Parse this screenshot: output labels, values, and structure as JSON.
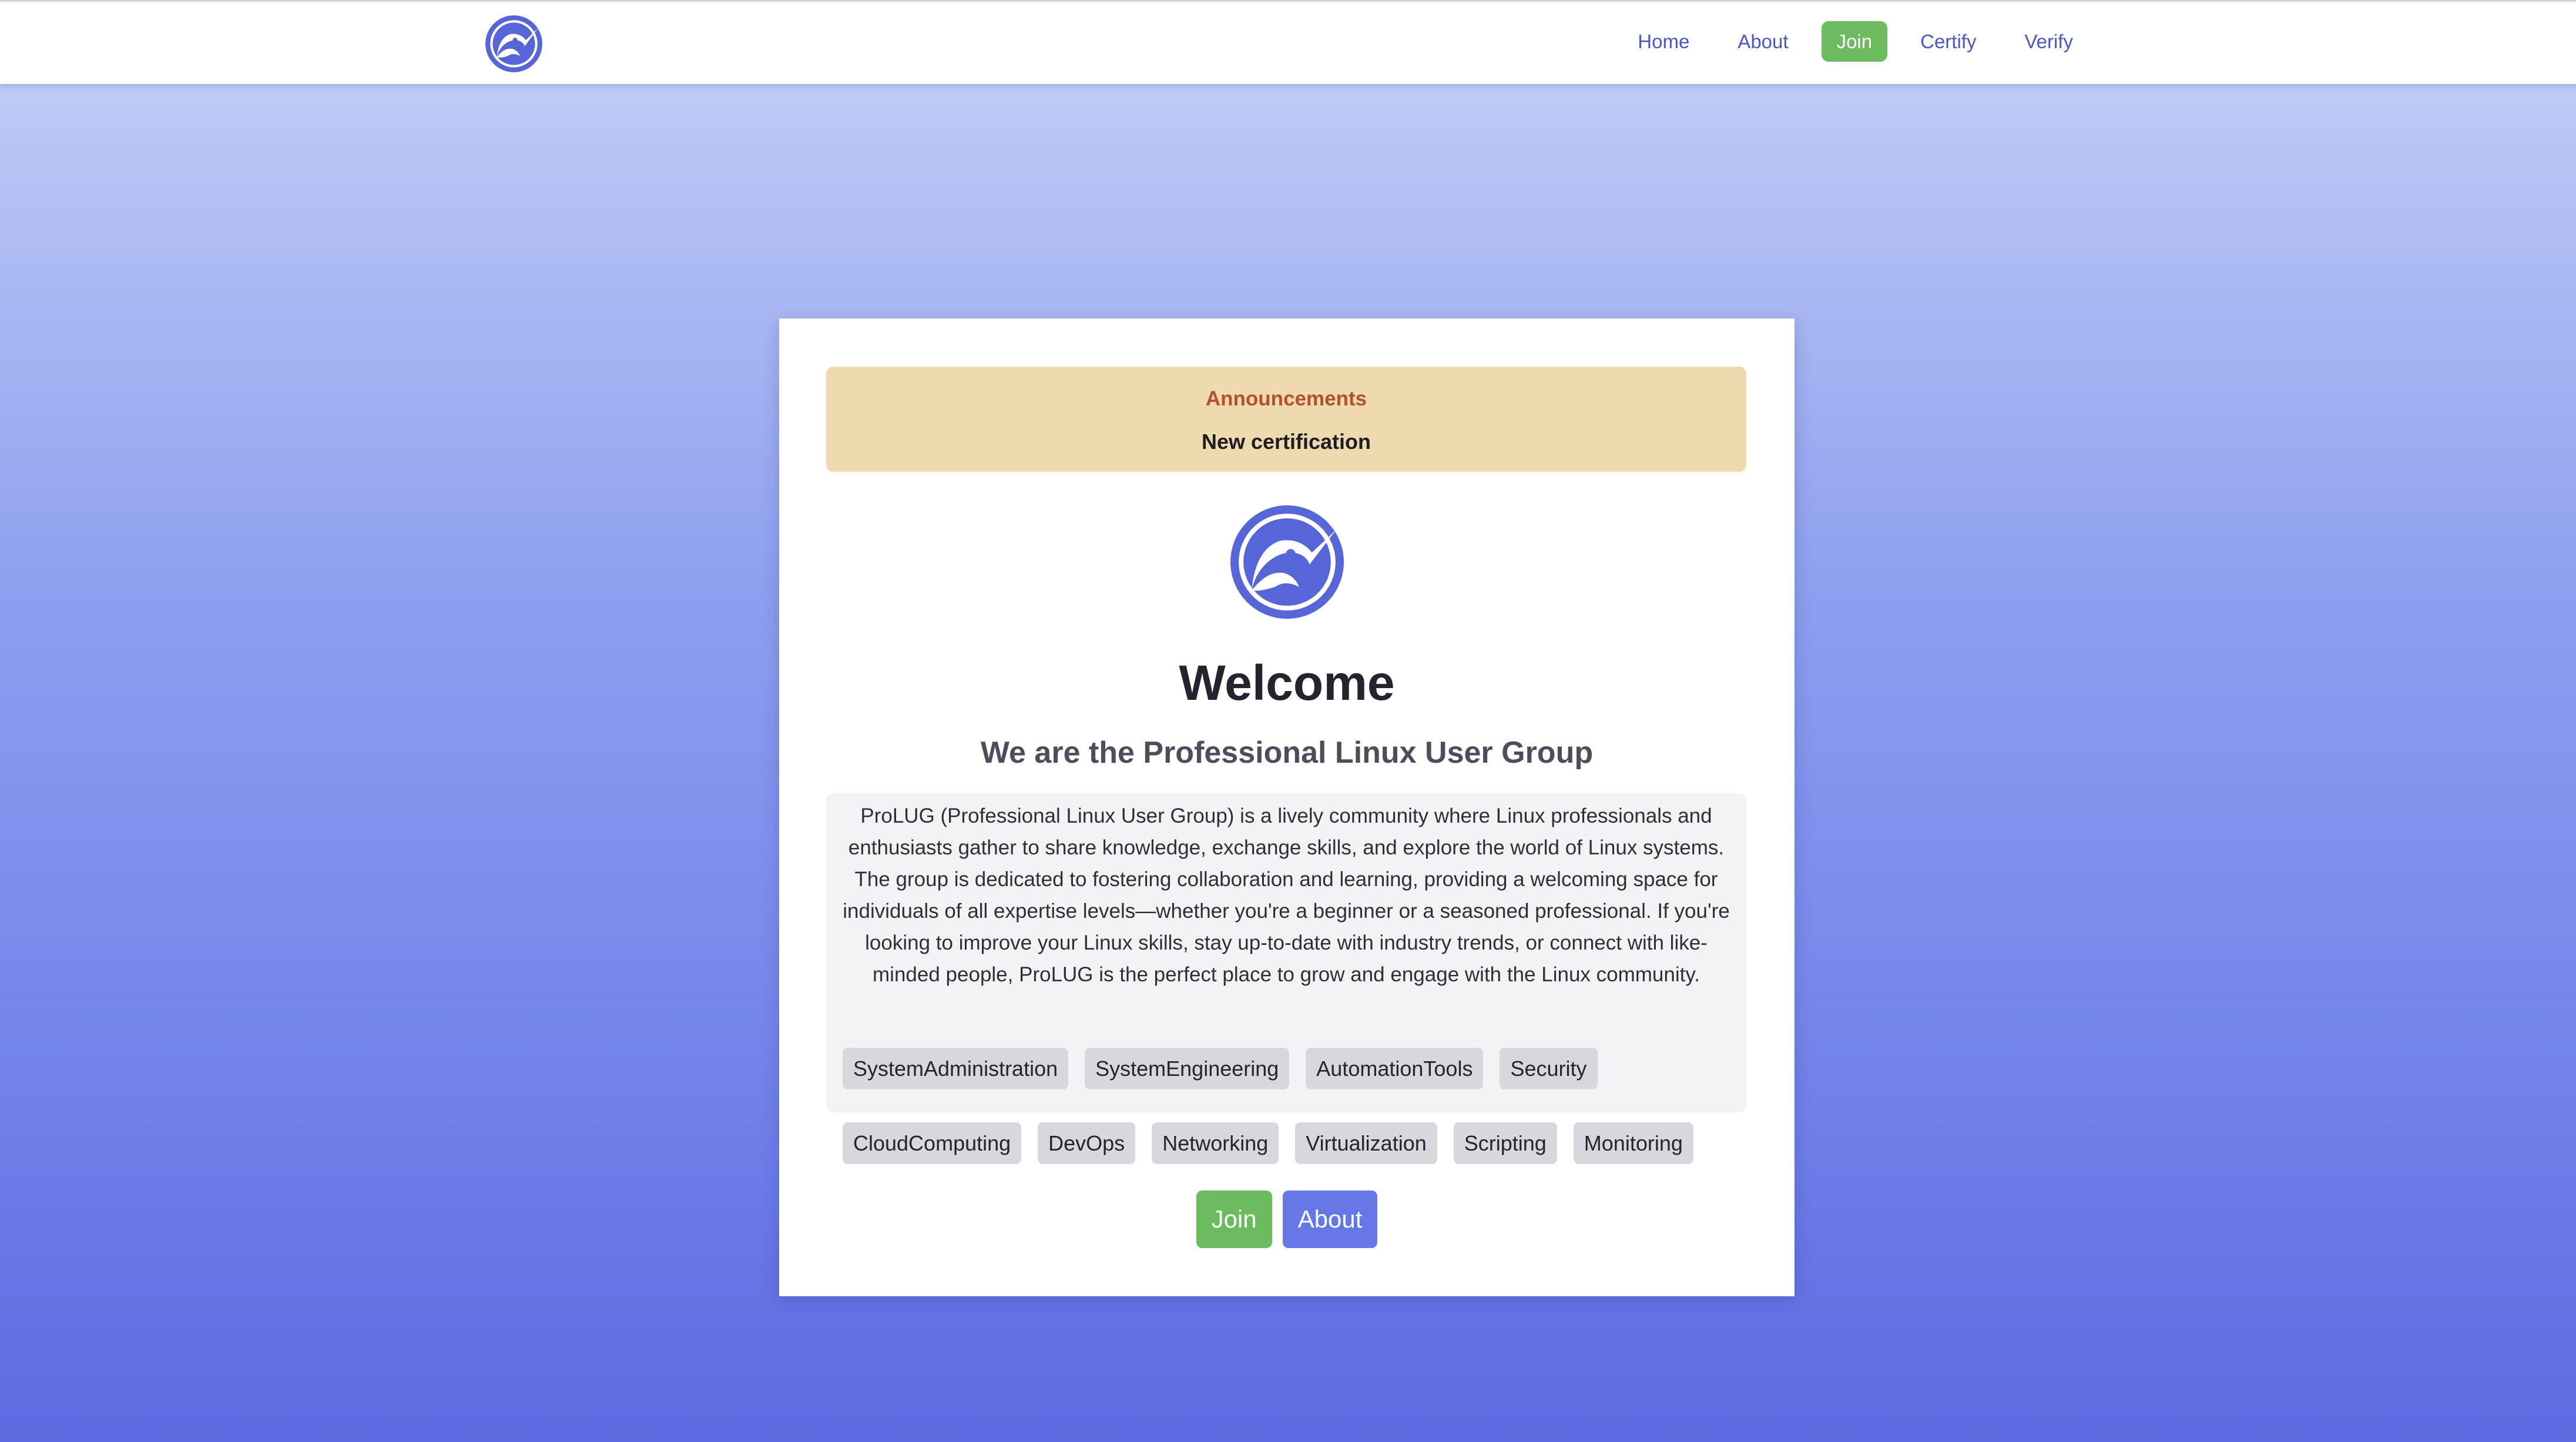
{
  "nav": {
    "links": [
      {
        "label": "Home"
      },
      {
        "label": "About"
      },
      {
        "label": "Join"
      },
      {
        "label": "Certify"
      },
      {
        "label": "Verify"
      }
    ],
    "active_index": 2
  },
  "logo": {
    "icon": "kiwi-bird-logo-icon"
  },
  "announcements": {
    "title": "Announcements",
    "body": "New certification"
  },
  "hero": {
    "title": "Welcome",
    "subtitle": "We are the Professional Linux User Group",
    "description": "ProLUG (Professional Linux User Group) is a lively community where Linux professionals and enthusiasts gather to share knowledge, exchange skills, and explore the world of Linux systems. The group is dedicated to fostering collaboration and learning, providing a welcoming space for individuals of all expertise levels—whether you're a beginner or a seasoned professional. If you're looking to improve your Linux skills, stay up-to-date with industry trends, or connect with like-minded people, ProLUG is the perfect place to grow and engage with the Linux community.",
    "tags": [
      "SystemAdministration",
      "SystemEngineering",
      "AutomationTools",
      "Security",
      "CloudComputing",
      "DevOps",
      "Networking",
      "Virtualization",
      "Scripting",
      "Monitoring"
    ]
  },
  "actions": {
    "join_label": "Join",
    "about_label": "About"
  },
  "colors": {
    "accent_blue": "#5b6be1",
    "join_green": "#6cbc5f",
    "announce_bg": "#efdab0",
    "announce_title": "#b5502d"
  }
}
